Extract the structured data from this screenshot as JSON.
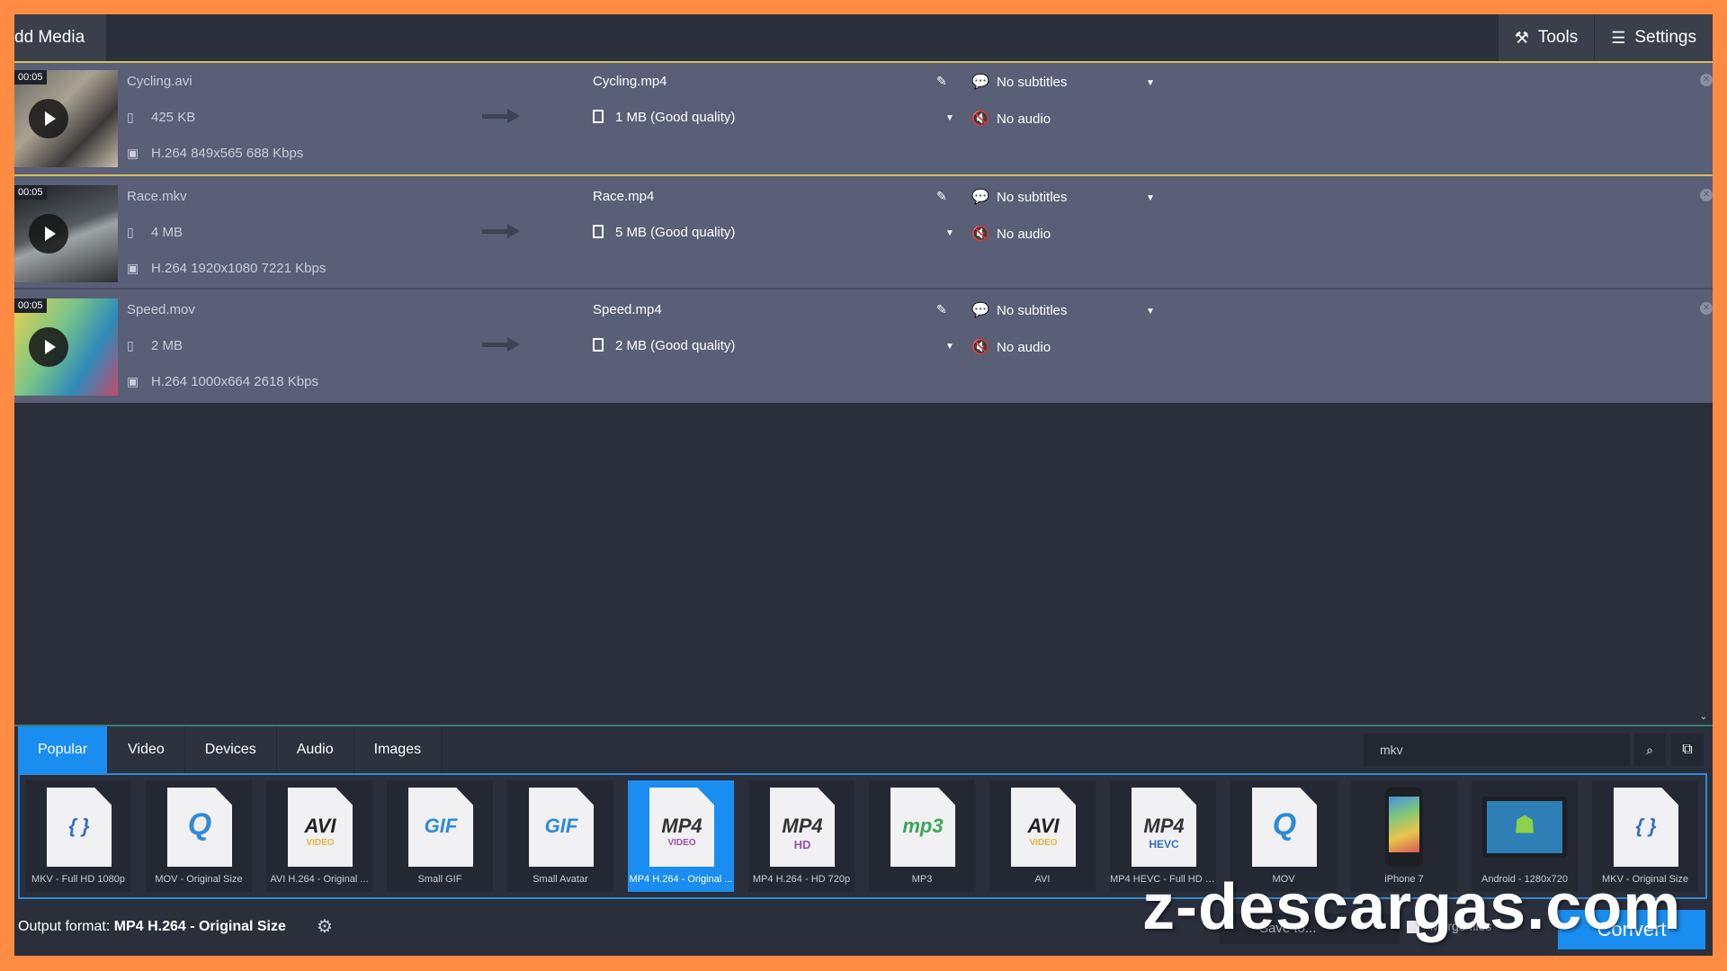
{
  "toolbar": {
    "add_media_label": "dd Media",
    "tools_label": "Tools",
    "settings_label": "Settings"
  },
  "files": [
    {
      "duration": "00:05",
      "source_name": "Cycling.avi",
      "source_size": "425 KB",
      "source_codec": "H.264 849x565 688 Kbps",
      "output_name": "Cycling.mp4",
      "output_size": "1 MB (Good quality)",
      "subtitles": "No subtitles",
      "audio": "No audio"
    },
    {
      "duration": "00:05",
      "source_name": "Race.mkv",
      "source_size": "4 MB",
      "source_codec": "H.264 1920x1080 7221 Kbps",
      "output_name": "Race.mp4",
      "output_size": "5 MB (Good quality)",
      "subtitles": "No subtitles",
      "audio": "No audio"
    },
    {
      "duration": "00:05",
      "source_name": "Speed.mov",
      "source_size": "2 MB",
      "source_codec": "H.264 1000x664 2618 Kbps",
      "output_name": "Speed.mp4",
      "output_size": "2 MB (Good quality)",
      "subtitles": "No subtitles",
      "audio": "No audio"
    }
  ],
  "tabs": [
    "Popular",
    "Video",
    "Devices",
    "Audio",
    "Images"
  ],
  "search": {
    "value": "mkv"
  },
  "formats": [
    {
      "badge": "{ }",
      "sub": "",
      "label": "MKV - Full HD 1080p",
      "color": "#2f6fc4"
    },
    {
      "badge": "Q",
      "sub": "",
      "label": "MOV - Original Size",
      "color": "#2f8ad8"
    },
    {
      "badge": "AVI",
      "sub": "VIDEO",
      "label": "AVI H.264 - Original ...",
      "color": "#222222"
    },
    {
      "badge": "GIF",
      "sub": "",
      "label": "Small GIF",
      "color": "#2f8ad8"
    },
    {
      "badge": "GIF",
      "sub": "",
      "label": "Small Avatar",
      "color": "#2f8ad8"
    },
    {
      "badge": "MP4",
      "sub": "VIDEO",
      "label": "MP4 H.264 - Original ...",
      "color": "#333333"
    },
    {
      "badge": "MP4",
      "sub": "HD",
      "label": "MP4 H.264 - HD 720p",
      "color": "#333333"
    },
    {
      "badge": "mp3",
      "sub": "",
      "label": "MP3",
      "color": "#3aa65a"
    },
    {
      "badge": "AVI",
      "sub": "VIDEO",
      "label": "AVI",
      "color": "#222222"
    },
    {
      "badge": "MP4",
      "sub": "HEVC",
      "label": "MP4 HEVC - Full HD 1...",
      "color": "#333333"
    },
    {
      "badge": "Q",
      "sub": "",
      "label": "MOV",
      "color": "#2f8ad8"
    },
    {
      "badge": "",
      "sub": "",
      "label": "iPhone 7",
      "color": "#1d1f24"
    },
    {
      "badge": "",
      "sub": "",
      "label": "Android - 1280x720",
      "color": "#8bd14a"
    },
    {
      "badge": "{ }",
      "sub": "",
      "label": "MKV - Original Size",
      "color": "#2f6fc4"
    }
  ],
  "footer": {
    "output_prefix": "Output format:",
    "output_value": "MP4 H.264 - Original Size",
    "save_to": "Save to...",
    "merge": "Merge files",
    "convert": "Convert"
  },
  "watermark": "z-descargas.com",
  "colors": {
    "accent": "#1a8df0",
    "frame": "#ff8c42",
    "selection": "#d8c05a"
  }
}
